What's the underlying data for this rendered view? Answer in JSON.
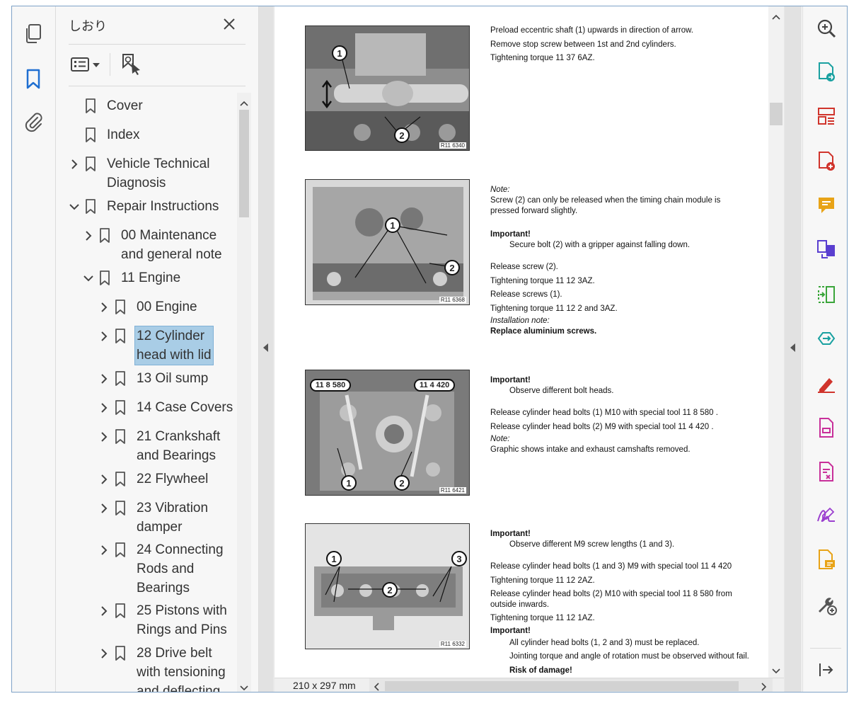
{
  "bookmarks_panel": {
    "title": "しおり",
    "items": [
      {
        "label": "Cover",
        "expand": ""
      },
      {
        "label": "Index",
        "expand": ""
      },
      {
        "label": "Vehicle Technical\nDiagnosis",
        "expand": "collapsed"
      },
      {
        "label": "Repair Instructions",
        "expand": "expanded"
      },
      {
        "label": "00 Maintenance\nand general note",
        "expand": "collapsed"
      },
      {
        "label": "11 Engine",
        "expand": "expanded"
      },
      {
        "label": "00 Engine",
        "expand": "collapsed"
      },
      {
        "label": "12 Cylinder\nhead with lid",
        "expand": "collapsed",
        "selected": true
      },
      {
        "label": "13 Oil sump",
        "expand": "collapsed"
      },
      {
        "label": "14 Case Covers",
        "expand": "collapsed"
      },
      {
        "label": "21 Crankshaft\nand Bearings",
        "expand": "collapsed"
      },
      {
        "label": "22 Flywheel",
        "expand": "collapsed"
      },
      {
        "label": "23 Vibration\ndamper",
        "expand": "collapsed"
      },
      {
        "label": "24 Connecting\nRods and\nBearings",
        "expand": "collapsed"
      },
      {
        "label": "25 Pistons with\nRings and Pins",
        "expand": "collapsed"
      },
      {
        "label": "28 Drive belt\nwith tensioning\nand deflecting",
        "expand": "collapsed"
      }
    ]
  },
  "document": {
    "page_size": "210 x 297 mm",
    "sections": [
      {
        "figure": {
          "code": "R11 6340",
          "callouts": [
            "1",
            "2"
          ]
        },
        "lines": [
          "Preload eccentric shaft (1) upwards in direction of arrow.",
          "Remove stop screw between 1st and 2nd cylinders.",
          "Tightening torque 11 37 6AZ."
        ]
      },
      {
        "figure": {
          "code": "R11 6368",
          "callouts": [
            "1",
            "2"
          ]
        },
        "note_label": "Note:",
        "note_text": "Screw (2) can only be released when the timing chain module is pressed forward slightly.",
        "important_label": "Important!",
        "important_text": "Secure bolt (2) with a gripper against falling down.",
        "lines": [
          "Release screw (2).",
          "Tightening torque 11 12 3AZ.",
          "Release screws (1).",
          "Tightening torque 11 12 2 and 3AZ."
        ],
        "install_label": "Installation note:",
        "install_text": "Replace aluminium screws."
      },
      {
        "figure": {
          "code": "R11 6421",
          "callouts": [
            "1",
            "2"
          ],
          "tags": [
            "11 8 580",
            "11 4 420"
          ]
        },
        "important_label": "Important!",
        "important_text": "Observe different bolt heads.",
        "lines": [
          "Release cylinder head bolts (1) M10 with special tool 11 8 580 .",
          "Release cylinder head bolts (2) M9 with special tool 11 4 420 ."
        ],
        "note_label": "Note:",
        "note_text": "Graphic shows intake and exhaust camshafts removed."
      },
      {
        "figure": {
          "code": "R11 6332",
          "callouts": [
            "1",
            "2",
            "3"
          ]
        },
        "important_label": "Important!",
        "important_text": "Observe different M9 screw lengths (1 and 3).",
        "lines": [
          "Release cylinder head bolts (1 and 3) M9 with special tool 11 4 420",
          "Tightening torque 11 12 2AZ.",
          "Release cylinder head bolts (2) M10 with special tool 11 8 580 from outside inwards.",
          "Tightening torque 11 12 1AZ."
        ],
        "important2_label": "Important!",
        "important2_lines": [
          "All cylinder head bolts (1, 2 and 3) must be replaced.",
          "Jointing torque and angle of rotation must be observed without fail.",
          "Risk of damage!"
        ]
      }
    ]
  },
  "colors": {
    "accent_red": "#d0342c",
    "accent_blue": "#1f6fd1",
    "accent_green": "#3aa53a",
    "accent_yellow": "#e8a317",
    "accent_purple": "#9b3fcf",
    "accent_pink": "#c8309a",
    "accent_teal": "#1aa1a1",
    "selection": "#a9cde6"
  },
  "icons": {
    "left_rail": [
      "pages-icon",
      "bookmark-icon",
      "attachment-icon"
    ],
    "right_tools": [
      "zoom-icon",
      "export-pdf-icon",
      "organize-pages-icon",
      "create-pdf-icon",
      "comment-icon",
      "combine-files-icon",
      "compress-icon",
      "compare-icon",
      "fill-sign-icon",
      "pdf-document-icon",
      "redact-icon",
      "signature-icon",
      "note-icon",
      "more-tools-icon",
      "collapse-pane-icon"
    ]
  }
}
